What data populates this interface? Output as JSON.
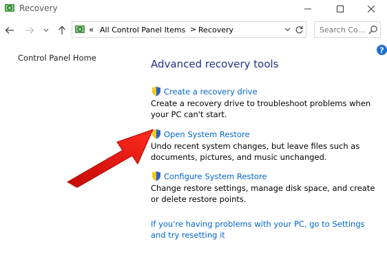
{
  "window": {
    "title": "Recovery",
    "icon": "recovery-icon",
    "controls": [
      "minimize-icon",
      "maximize-icon",
      "close-icon"
    ]
  },
  "navigation": {
    "back_icon": "arrow-left-icon",
    "forward_icon": "arrow-right-icon",
    "recent_icon": "chevron-down-icon",
    "up_icon": "arrow-up-icon"
  },
  "address_bar": {
    "overflow_chevron": "«",
    "breadcrumbs": [
      "All Control Panel Items",
      "Recovery"
    ],
    "separator": ">",
    "dropdown_icon": "chevron-down-icon",
    "refresh_icon": "refresh-icon"
  },
  "search": {
    "placeholder": "Search Co...",
    "icon": "search-icon"
  },
  "sidebar": {
    "home_link": "Control Panel Home"
  },
  "main": {
    "heading": "Advanced recovery tools",
    "tools": [
      {
        "title": "Create a recovery drive",
        "description": "Create a recovery drive to troubleshoot problems when your PC can't start.",
        "icon": "shield-icon"
      },
      {
        "title": "Open System Restore",
        "description": "Undo recent system changes, but leave files such as documents, pictures, and music unchanged.",
        "icon": "shield-icon"
      },
      {
        "title": "Configure System Restore",
        "description": "Change restore settings, manage disk space, and create or delete restore points.",
        "icon": "shield-icon"
      }
    ],
    "footer_link": "If you're having problems with your PC, go to Settings and try resetting it"
  },
  "colors": {
    "link": "#0066cc",
    "heading": "#1e3287",
    "annotation_arrow": "#e8120c",
    "help_badge": "#1e6fd1"
  },
  "annotation": {
    "icon": "red-arrow-icon"
  }
}
